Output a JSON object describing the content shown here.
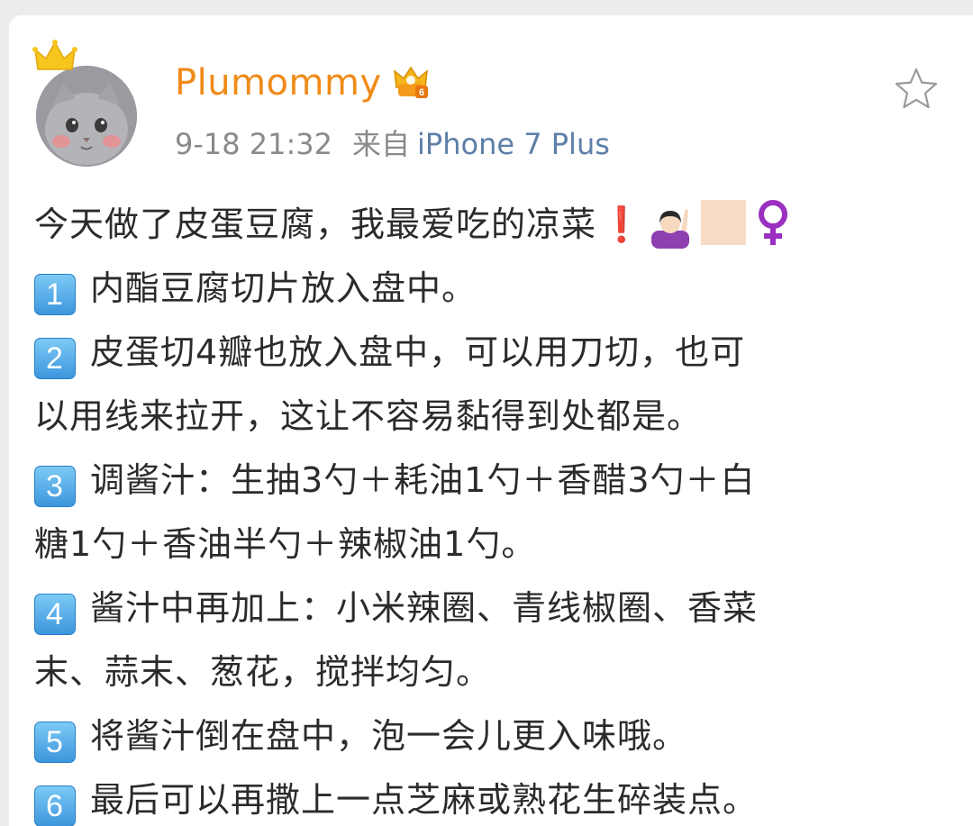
{
  "post": {
    "author": {
      "name": "Plumommy",
      "vip_level": "6"
    },
    "meta": {
      "time": "9-18 21:32",
      "from_label": "来自",
      "device": "iPhone 7 Plus"
    },
    "intro": "今天做了皮蛋豆腐，我最爱吃的凉菜",
    "intro_emoji": {
      "exclamation": "❗",
      "icons": [
        "raising-hand-emoji",
        "skin-tone-modifier",
        "female-sign"
      ]
    },
    "steps": [
      {
        "num": "1",
        "lines": [
          "内酯豆腐切片放入盘中。"
        ]
      },
      {
        "num": "2",
        "lines": [
          "皮蛋切4瓣也放入盘中，可以用刀切，也可",
          "以用线来拉开，这让不容易黏得到处都是。"
        ]
      },
      {
        "num": "3",
        "lines": [
          "调酱汁：生抽3勺＋耗油1勺＋香醋3勺＋白",
          "糖1勺＋香油半勺＋辣椒油1勺。"
        ]
      },
      {
        "num": "4",
        "lines": [
          "酱汁中再加上：小米辣圈、青线椒圈、香菜",
          "末、蒜末、葱花，搅拌均匀。"
        ]
      },
      {
        "num": "5",
        "lines": [
          "将酱汁倒在盘中，泡一会儿更入味哦。"
        ]
      },
      {
        "num": "6",
        "lines": [
          "最后可以再撒上一点芝麻或熟花生碎装点。"
        ]
      }
    ],
    "colors": {
      "username": "#f08a18",
      "meta": "#8a8a8a",
      "device_link": "#5d7fa8",
      "step_badge": "#3d96dd"
    }
  }
}
